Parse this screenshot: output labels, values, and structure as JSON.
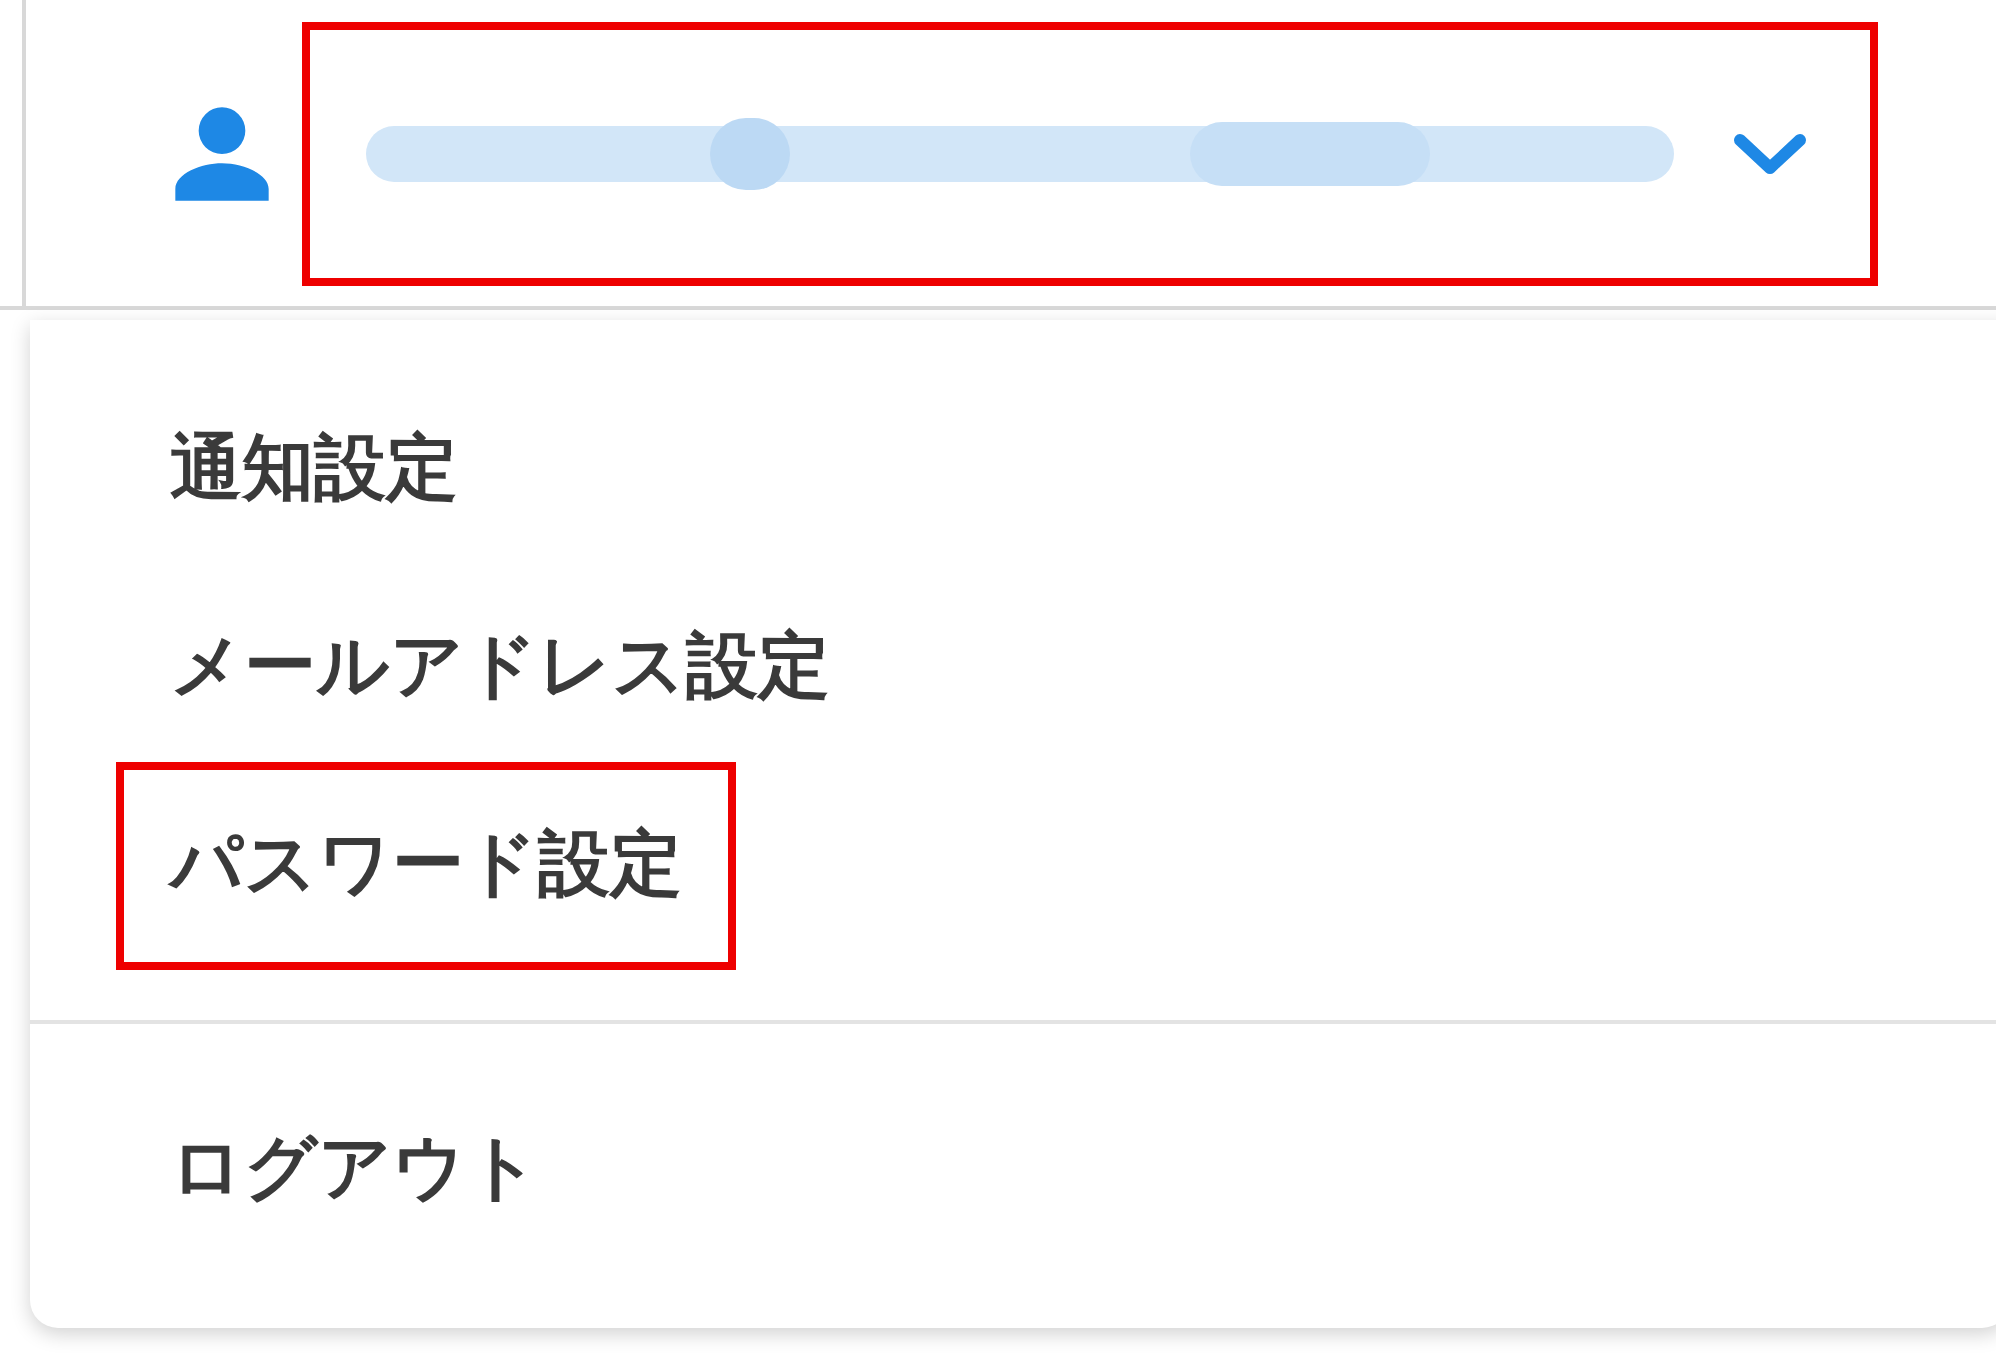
{
  "account": {
    "highlighted": true
  },
  "menu": {
    "items": [
      {
        "label": "通知設定",
        "highlighted": false
      },
      {
        "label": "メールアドレス設定",
        "highlighted": false
      },
      {
        "label": "パスワード設定",
        "highlighted": true
      }
    ],
    "footer_items": [
      {
        "label": "ログアウト",
        "highlighted": false
      }
    ]
  }
}
